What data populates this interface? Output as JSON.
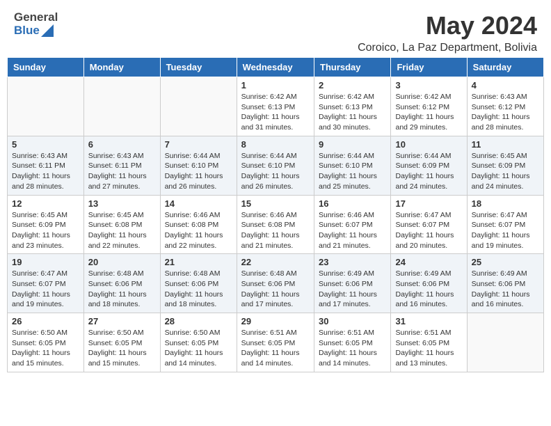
{
  "logo": {
    "general": "General",
    "blue": "Blue"
  },
  "header": {
    "month": "May 2024",
    "location": "Coroico, La Paz Department, Bolivia"
  },
  "weekdays": [
    "Sunday",
    "Monday",
    "Tuesday",
    "Wednesday",
    "Thursday",
    "Friday",
    "Saturday"
  ],
  "weeks": [
    [
      {
        "day": "",
        "info": ""
      },
      {
        "day": "",
        "info": ""
      },
      {
        "day": "",
        "info": ""
      },
      {
        "day": "1",
        "info": "Sunrise: 6:42 AM\nSunset: 6:13 PM\nDaylight: 11 hours and 31 minutes."
      },
      {
        "day": "2",
        "info": "Sunrise: 6:42 AM\nSunset: 6:13 PM\nDaylight: 11 hours and 30 minutes."
      },
      {
        "day": "3",
        "info": "Sunrise: 6:42 AM\nSunset: 6:12 PM\nDaylight: 11 hours and 29 minutes."
      },
      {
        "day": "4",
        "info": "Sunrise: 6:43 AM\nSunset: 6:12 PM\nDaylight: 11 hours and 28 minutes."
      }
    ],
    [
      {
        "day": "5",
        "info": "Sunrise: 6:43 AM\nSunset: 6:11 PM\nDaylight: 11 hours and 28 minutes."
      },
      {
        "day": "6",
        "info": "Sunrise: 6:43 AM\nSunset: 6:11 PM\nDaylight: 11 hours and 27 minutes."
      },
      {
        "day": "7",
        "info": "Sunrise: 6:44 AM\nSunset: 6:10 PM\nDaylight: 11 hours and 26 minutes."
      },
      {
        "day": "8",
        "info": "Sunrise: 6:44 AM\nSunset: 6:10 PM\nDaylight: 11 hours and 26 minutes."
      },
      {
        "day": "9",
        "info": "Sunrise: 6:44 AM\nSunset: 6:10 PM\nDaylight: 11 hours and 25 minutes."
      },
      {
        "day": "10",
        "info": "Sunrise: 6:44 AM\nSunset: 6:09 PM\nDaylight: 11 hours and 24 minutes."
      },
      {
        "day": "11",
        "info": "Sunrise: 6:45 AM\nSunset: 6:09 PM\nDaylight: 11 hours and 24 minutes."
      }
    ],
    [
      {
        "day": "12",
        "info": "Sunrise: 6:45 AM\nSunset: 6:09 PM\nDaylight: 11 hours and 23 minutes."
      },
      {
        "day": "13",
        "info": "Sunrise: 6:45 AM\nSunset: 6:08 PM\nDaylight: 11 hours and 22 minutes."
      },
      {
        "day": "14",
        "info": "Sunrise: 6:46 AM\nSunset: 6:08 PM\nDaylight: 11 hours and 22 minutes."
      },
      {
        "day": "15",
        "info": "Sunrise: 6:46 AM\nSunset: 6:08 PM\nDaylight: 11 hours and 21 minutes."
      },
      {
        "day": "16",
        "info": "Sunrise: 6:46 AM\nSunset: 6:07 PM\nDaylight: 11 hours and 21 minutes."
      },
      {
        "day": "17",
        "info": "Sunrise: 6:47 AM\nSunset: 6:07 PM\nDaylight: 11 hours and 20 minutes."
      },
      {
        "day": "18",
        "info": "Sunrise: 6:47 AM\nSunset: 6:07 PM\nDaylight: 11 hours and 19 minutes."
      }
    ],
    [
      {
        "day": "19",
        "info": "Sunrise: 6:47 AM\nSunset: 6:07 PM\nDaylight: 11 hours and 19 minutes."
      },
      {
        "day": "20",
        "info": "Sunrise: 6:48 AM\nSunset: 6:06 PM\nDaylight: 11 hours and 18 minutes."
      },
      {
        "day": "21",
        "info": "Sunrise: 6:48 AM\nSunset: 6:06 PM\nDaylight: 11 hours and 18 minutes."
      },
      {
        "day": "22",
        "info": "Sunrise: 6:48 AM\nSunset: 6:06 PM\nDaylight: 11 hours and 17 minutes."
      },
      {
        "day": "23",
        "info": "Sunrise: 6:49 AM\nSunset: 6:06 PM\nDaylight: 11 hours and 17 minutes."
      },
      {
        "day": "24",
        "info": "Sunrise: 6:49 AM\nSunset: 6:06 PM\nDaylight: 11 hours and 16 minutes."
      },
      {
        "day": "25",
        "info": "Sunrise: 6:49 AM\nSunset: 6:06 PM\nDaylight: 11 hours and 16 minutes."
      }
    ],
    [
      {
        "day": "26",
        "info": "Sunrise: 6:50 AM\nSunset: 6:05 PM\nDaylight: 11 hours and 15 minutes."
      },
      {
        "day": "27",
        "info": "Sunrise: 6:50 AM\nSunset: 6:05 PM\nDaylight: 11 hours and 15 minutes."
      },
      {
        "day": "28",
        "info": "Sunrise: 6:50 AM\nSunset: 6:05 PM\nDaylight: 11 hours and 14 minutes."
      },
      {
        "day": "29",
        "info": "Sunrise: 6:51 AM\nSunset: 6:05 PM\nDaylight: 11 hours and 14 minutes."
      },
      {
        "day": "30",
        "info": "Sunrise: 6:51 AM\nSunset: 6:05 PM\nDaylight: 11 hours and 14 minutes."
      },
      {
        "day": "31",
        "info": "Sunrise: 6:51 AM\nSunset: 6:05 PM\nDaylight: 11 hours and 13 minutes."
      },
      {
        "day": "",
        "info": ""
      }
    ]
  ]
}
